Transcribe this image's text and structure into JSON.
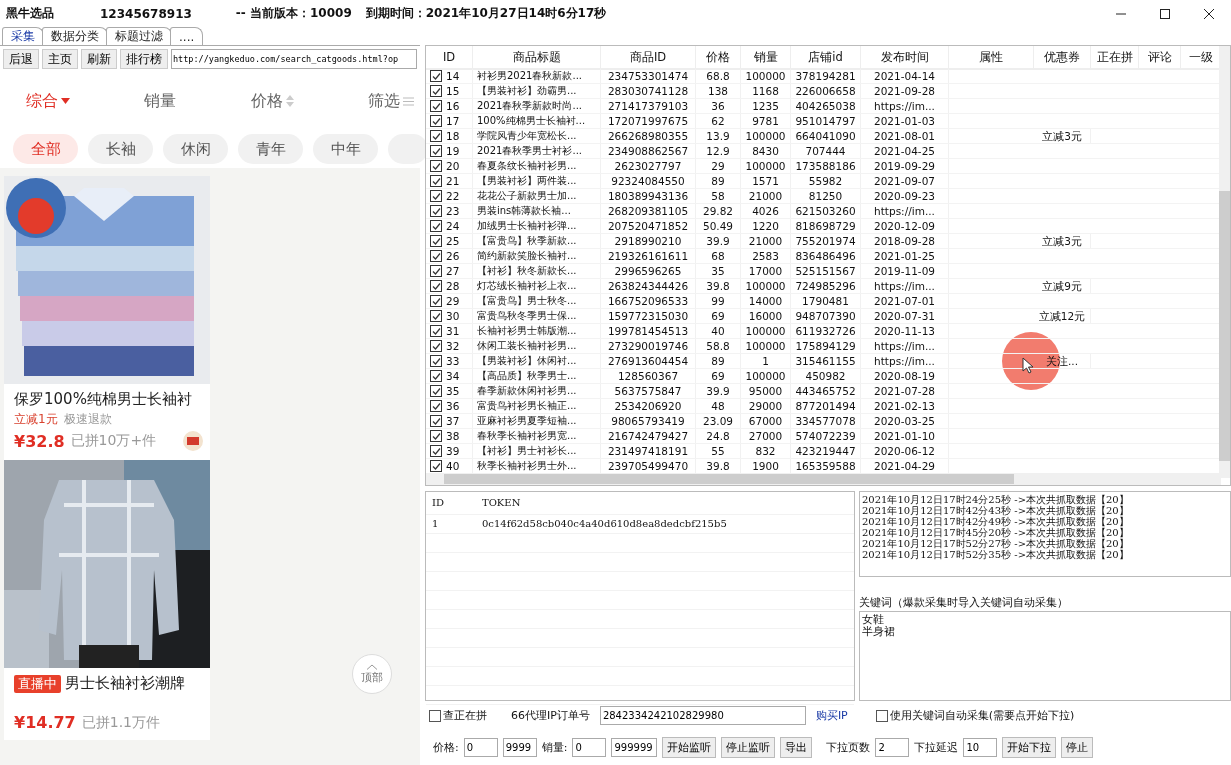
{
  "window": {
    "app_name": "黑牛选品",
    "account": "12345678913",
    "version": "-- 当前版本：10009",
    "expiry": "到期时间：2021年10月27日14时6分17秒"
  },
  "tabs": [
    {
      "label": "采集",
      "selected": true
    },
    {
      "label": "数据分类",
      "selected": false
    },
    {
      "label": "标题过滤",
      "selected": false
    },
    {
      "label": "....",
      "selected": false
    }
  ],
  "toolbar": {
    "buttons": [
      "后退",
      "主页",
      "刷新",
      "排行榜"
    ],
    "url": "http://yangkeduo.com/search_catgoods.html?op"
  },
  "browser": {
    "sort_options": [
      {
        "label": "综合",
        "selected": true,
        "kind": "dropdown"
      },
      {
        "label": "销量",
        "selected": false,
        "kind": "plain"
      },
      {
        "label": "价格",
        "selected": false,
        "kind": "sortable"
      },
      {
        "label": "筛选",
        "selected": false,
        "kind": "filter"
      }
    ],
    "chips": [
      {
        "label": "全部",
        "selected": true
      },
      {
        "label": "长袖",
        "selected": false
      },
      {
        "label": "休闲",
        "selected": false
      },
      {
        "label": "青年",
        "selected": false
      },
      {
        "label": "中年",
        "selected": false
      }
    ],
    "products": [
      {
        "kind": "folded",
        "title": "保罗100%纯棉男士长袖衬",
        "tags": [
          "立减1元",
          "极速退款"
        ],
        "price": "¥32.8",
        "sold": "已拼10万+件",
        "shop_icon": true
      },
      {
        "kind": "model",
        "badge": "直播中",
        "title": "男士长袖衬衫潮牌",
        "price": "¥14.77",
        "sold": "已拼1.1万件",
        "shop_icon": false
      }
    ],
    "back_to_top": "顶部"
  },
  "table": {
    "columns": [
      "ID",
      "商品标题",
      "商品ID",
      "价格",
      "销量",
      "店铺id",
      "发布时间",
      "属性",
      "优惠券",
      "正在拼",
      "评论",
      "一级"
    ],
    "rows": [
      {
        "checked": true,
        "cells": [
          "14",
          "衬衫男2021春秋新款...",
          "234753301474",
          "68.8",
          "100000",
          "378194281",
          "2021-04-14",
          "",
          "",
          "",
          "",
          ""
        ]
      },
      {
        "checked": true,
        "cells": [
          "15",
          "【男装衬衫】劲霸男...",
          "283030741128",
          "138",
          "1168",
          "226006658",
          "2021-09-28",
          "",
          "",
          "",
          "",
          ""
        ]
      },
      {
        "checked": true,
        "cells": [
          "16",
          "2021春秋季新款时尚...",
          "271417379103",
          "36",
          "1235",
          "404265038",
          "https://im...",
          "",
          "",
          "",
          "",
          ""
        ]
      },
      {
        "checked": true,
        "cells": [
          "17",
          "100%纯棉男士长袖衬...",
          "172071997675",
          "62",
          "9781",
          "951014797",
          "2021-01-03",
          "",
          "",
          "",
          "",
          ""
        ]
      },
      {
        "checked": true,
        "cells": [
          "18",
          "学院风青少年宽松长...",
          "266268980355",
          "13.9",
          "100000",
          "664041090",
          "2021-08-01",
          "",
          "立减3元",
          "",
          "",
          ""
        ]
      },
      {
        "checked": true,
        "cells": [
          "19",
          "2021春秋季男士衬衫...",
          "234908862567",
          "12.9",
          "8430",
          "707444",
          "2021-04-25",
          "",
          "",
          "",
          "",
          ""
        ]
      },
      {
        "checked": true,
        "cells": [
          "20",
          "春夏条纹长袖衬衫男...",
          "2623027797",
          "29",
          "100000",
          "173588186",
          "2019-09-29",
          "",
          "",
          "",
          "",
          ""
        ]
      },
      {
        "checked": true,
        "cells": [
          "21",
          "【男装衬衫】两件装...",
          "92324084550",
          "89",
          "1571",
          "55982",
          "2021-09-07",
          "",
          "",
          "",
          "",
          ""
        ]
      },
      {
        "checked": true,
        "cells": [
          "22",
          "花花公子新款男士加...",
          "180389943136",
          "58",
          "21000",
          "81250",
          "2020-09-23",
          "",
          "",
          "",
          "",
          ""
        ]
      },
      {
        "checked": true,
        "cells": [
          "23",
          "男装ins韩薄款长袖...",
          "268209381105",
          "29.82",
          "4026",
          "621503260",
          "https://im...",
          "",
          "",
          "",
          "",
          ""
        ]
      },
      {
        "checked": true,
        "cells": [
          "24",
          "加绒男士长袖衬衫弹...",
          "207520471852",
          "50.49",
          "1220",
          "818698729",
          "2020-12-09",
          "",
          "",
          "",
          "",
          ""
        ]
      },
      {
        "checked": true,
        "cells": [
          "25",
          "【富贵鸟】秋季新款...",
          "2918990210",
          "39.9",
          "21000",
          "755201974",
          "2018-09-28",
          "",
          "立减3元",
          "",
          "",
          ""
        ]
      },
      {
        "checked": true,
        "cells": [
          "26",
          "简约新款笑脸长袖衬...",
          "219326161611",
          "68",
          "2583",
          "836486496",
          "2021-01-25",
          "",
          "",
          "",
          "",
          ""
        ]
      },
      {
        "checked": true,
        "cells": [
          "27",
          "【衬衫】秋冬新款长...",
          "2996596265",
          "35",
          "17000",
          "525151567",
          "2019-11-09",
          "",
          "",
          "",
          "",
          ""
        ]
      },
      {
        "checked": true,
        "cells": [
          "28",
          "灯芯绒长袖衬衫上衣...",
          "263824344426",
          "39.8",
          "100000",
          "724985296",
          "https://im...",
          "",
          "立减9元",
          "",
          "",
          ""
        ]
      },
      {
        "checked": true,
        "cells": [
          "29",
          "【富贵鸟】男士秋冬...",
          "166752096533",
          "99",
          "14000",
          "1790481",
          "2021-07-01",
          "",
          "",
          "",
          "",
          ""
        ]
      },
      {
        "checked": true,
        "cells": [
          "30",
          "富贵鸟秋冬季男士保...",
          "159772315030",
          "69",
          "16000",
          "948707390",
          "2020-07-31",
          "",
          "立减12元",
          "",
          "",
          ""
        ]
      },
      {
        "checked": true,
        "cells": [
          "31",
          "长袖衬衫男士韩版潮...",
          "199781454513",
          "40",
          "100000",
          "611932726",
          "2020-11-13",
          "",
          "",
          "",
          "",
          ""
        ]
      },
      {
        "checked": true,
        "cells": [
          "32",
          "休闲工装长袖衬衫男...",
          "273290019746",
          "58.8",
          "100000",
          "175894129",
          "https://im...",
          "",
          "",
          "",
          "",
          ""
        ]
      },
      {
        "checked": true,
        "cells": [
          "33",
          "【男装衬衫】休闲衬...",
          "276913604454",
          "89",
          "1",
          "315461155",
          "https://im...",
          "",
          "关注...",
          "",
          "",
          ""
        ]
      },
      {
        "checked": true,
        "cells": [
          "34",
          "【高品质】秋季男士...",
          "128560367",
          "69",
          "100000",
          "450982",
          "2020-08-19",
          "",
          "",
          "",
          "",
          ""
        ]
      },
      {
        "checked": true,
        "cells": [
          "35",
          "春季新款休闲衬衫男...",
          "5637575847",
          "39.9",
          "95000",
          "443465752",
          "2021-07-28",
          "",
          "",
          "",
          "",
          ""
        ]
      },
      {
        "checked": true,
        "cells": [
          "36",
          "富贵鸟衬衫男长袖正...",
          "2534206920",
          "48",
          "29000",
          "877201494",
          "2021-02-13",
          "",
          "",
          "",
          "",
          ""
        ]
      },
      {
        "checked": true,
        "cells": [
          "37",
          "亚麻衬衫男夏季短袖...",
          "98065793419",
          "23.09",
          "67000",
          "334577078",
          "2020-03-25",
          "",
          "",
          "",
          "",
          ""
        ]
      },
      {
        "checked": true,
        "cells": [
          "38",
          "春秋季长袖衬衫男宽...",
          "216742479427",
          "24.8",
          "27000",
          "574072239",
          "2021-01-10",
          "",
          "",
          "",
          "",
          ""
        ]
      },
      {
        "checked": true,
        "cells": [
          "39",
          "【衬衫】男士衬衫长...",
          "231497418191",
          "55",
          "832",
          "423219447",
          "2020-06-12",
          "",
          "",
          "",
          "",
          ""
        ]
      },
      {
        "checked": true,
        "cells": [
          "40",
          "秋季长袖衬衫男士外...",
          "239705499470",
          "39.8",
          "1900",
          "165359588",
          "2021-04-29",
          "",
          "",
          "",
          "",
          ""
        ]
      }
    ]
  },
  "token_table": {
    "columns": [
      "ID",
      "TOKEN"
    ],
    "rows": [
      [
        "1",
        "0c14f62d58cb040c4a40d610d8ea8dedcbf215b5"
      ]
    ]
  },
  "log": [
    "2021年10月12日17时24分25秒 ->本次共抓取数据【20】",
    "2021年10月12日17时42分43秒 ->本次共抓取数据【20】",
    "2021年10月12日17时42分49秒 ->本次共抓取数据【20】",
    "2021年10月12日17时45分20秒 ->本次共抓取数据【20】",
    "2021年10月12日17时52分27秒 ->本次共抓取数据【20】",
    "2021年10月12日17时52分35秒 ->本次共抓取数据【20】"
  ],
  "keywords": {
    "label": "关键词（爆款采集时导入关键词自动采集）",
    "lines": [
      "女鞋",
      "半身裙"
    ]
  },
  "options": {
    "check_pinning": {
      "label": "查正在拼",
      "checked": false
    },
    "proxy_label": "66代理IP订单号",
    "proxy_value": "2842334242102829980",
    "buy_link": "购买IP",
    "use_keywords": {
      "label": "使用关键词自动采集(需要点开始下拉)",
      "checked": false
    }
  },
  "filters": {
    "price_label": "价格:",
    "price_min": "0",
    "price_max": "9999",
    "sales_label": "销量:",
    "sales_min": "0",
    "sales_max": "999999",
    "buttons": [
      "开始监听",
      "停止监听",
      "导出"
    ],
    "pages_label": "下拉页数",
    "pages": "2",
    "delay_label": "下拉延迟",
    "delay": "10",
    "pull_buttons": [
      "开始下拉",
      "停止"
    ]
  }
}
